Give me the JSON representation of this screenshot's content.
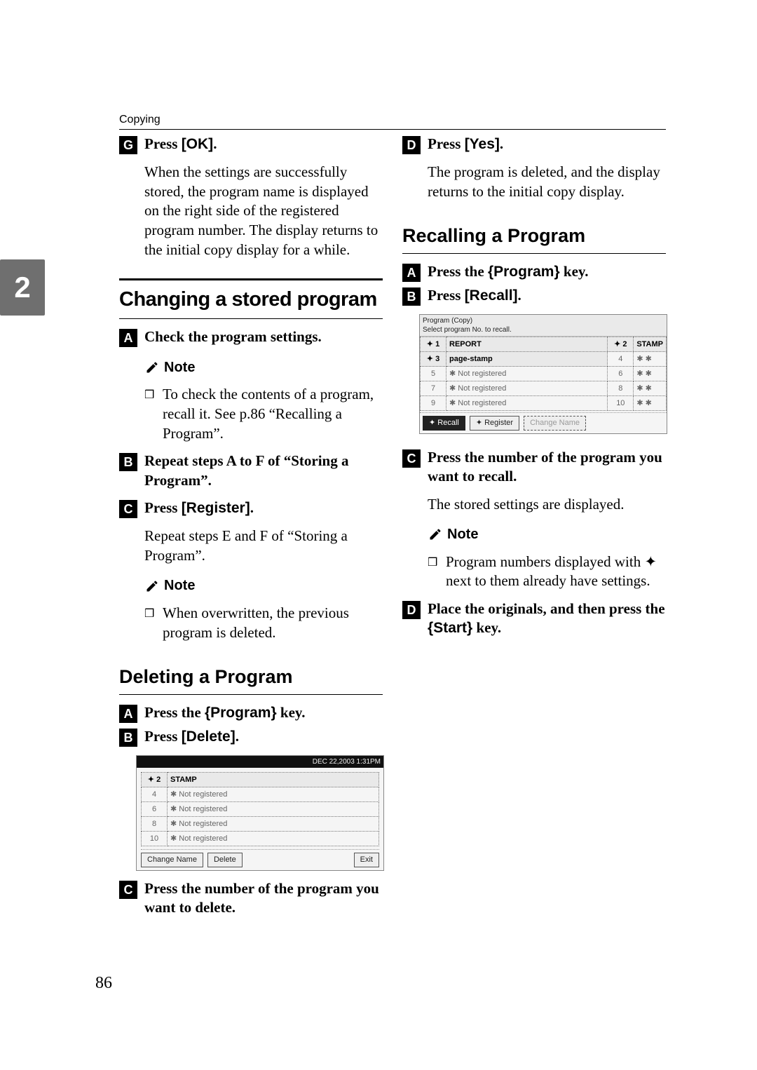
{
  "page": {
    "running_head": "Copying",
    "number": "86",
    "side_tab": "2"
  },
  "left": {
    "stepG": {
      "num": "G",
      "label_prefix": "Press ",
      "key": "[OK]",
      "label_suffix": ".",
      "body": "When the settings are successfully stored, the program name is displayed on the right side of the registered program number. The display returns to the initial copy display for a while."
    },
    "section_title": "Changing a stored program",
    "stepA": {
      "num": "A",
      "text": "Check the program settings."
    },
    "note_label": "Note",
    "note_bullet": "To check the contents of a program, recall it. See p.86 “Recalling a Program”.",
    "stepB": {
      "num": "B",
      "text": "Repeat steps A to F of “Storing a Program”."
    },
    "stepC": {
      "num": "C",
      "label_prefix": "Press ",
      "key": "[Register]",
      "label_suffix": ".",
      "body": "Repeat steps E and F of “Storing a Program”."
    },
    "note2_label": "Note",
    "note2_bullet": "When overwritten, the previous program is deleted.",
    "subsection_title": "Deleting a Program",
    "del_stepA": {
      "num": "A",
      "label_prefix": "Press the ",
      "key": "Program",
      "label_suffix": " key."
    },
    "del_stepB": {
      "num": "B",
      "label_prefix": "Press ",
      "key": "[Delete]",
      "label_suffix": "."
    },
    "figure": {
      "clock": "DEC   22,2003  1:31PM",
      "rows": [
        {
          "n": "✦ 2",
          "name": "STAMP"
        },
        {
          "n": "4",
          "name": "✱ Not registered"
        },
        {
          "n": "6",
          "name": "✱ Not registered"
        },
        {
          "n": "8",
          "name": "✱ Not registered"
        },
        {
          "n": "10",
          "name": "✱ Not registered"
        }
      ],
      "btn_change": "Change Name",
      "btn_delete": "Delete",
      "btn_exit": "Exit"
    },
    "del_stepC": {
      "num": "C",
      "text": "Press the number of the program you want to delete."
    }
  },
  "right": {
    "stepD": {
      "num": "D",
      "label_prefix": "Press ",
      "key": "[Yes]",
      "label_suffix": ".",
      "body": "The program is deleted, and the display returns to the initial copy display."
    },
    "subsection_title": "Recalling a Program",
    "rec_stepA": {
      "num": "A",
      "label_prefix": "Press the ",
      "key": "Program",
      "label_suffix": " key."
    },
    "rec_stepB": {
      "num": "B",
      "label_prefix": "Press ",
      "key": "[Recall]",
      "label_suffix": "."
    },
    "figure": {
      "title": "Program (Copy)",
      "subtitle": "Select program No. to recall.",
      "rows": [
        {
          "a": "✦ 1",
          "an": "REPORT",
          "b": "✦ 2",
          "bn": "STAMP"
        },
        {
          "a": "✦ 3",
          "an": "page-stamp",
          "b": "4",
          "bn": "✱ ✱"
        },
        {
          "a": "5",
          "an": "✱ Not registered",
          "b": "6",
          "bn": "✱ ✱"
        },
        {
          "a": "7",
          "an": "✱ Not registered",
          "b": "8",
          "bn": "✱ ✱"
        },
        {
          "a": "9",
          "an": "✱ Not registered",
          "b": "10",
          "bn": "✱ ✱"
        }
      ],
      "btn_recall": "✦ Recall",
      "btn_register": "✦ Register",
      "btn_change": "Change Name"
    },
    "rec_stepC": {
      "num": "C",
      "text": "Press the number of the program you want to recall.",
      "body": "The stored settings are displayed."
    },
    "note_label": "Note",
    "note_bullet": "Program numbers displayed with ✦ next to them already have settings.",
    "rec_stepD": {
      "num": "D",
      "label_prefix": "Place the originals, and then press the ",
      "key": "Start",
      "label_suffix": " key."
    }
  }
}
